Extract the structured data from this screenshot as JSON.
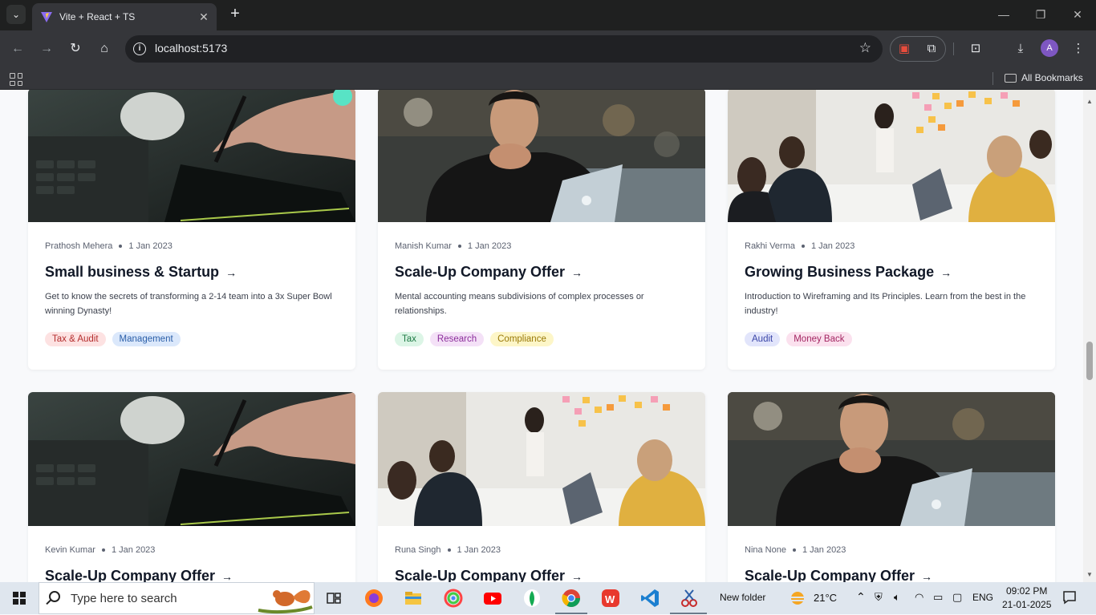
{
  "browser": {
    "tab_title": "Vite + React + TS",
    "url": "localhost:5173",
    "bookmarks_label": "All Bookmarks",
    "profile_initial": "A"
  },
  "cards": [
    {
      "author": "Prathosh Mehera",
      "date": "1 Jan 2023",
      "title": "Small business & Startup",
      "description": "Get to know the secrets of transforming a 2-14 team into a 3x Super Bowl winning Dynasty!",
      "tags": [
        {
          "label": "Tax & Audit",
          "bg": "#fde2e2",
          "fg": "#b42d2d"
        },
        {
          "label": "Management",
          "bg": "#dbe8fb",
          "fg": "#2a5ea8"
        }
      ]
    },
    {
      "author": "Manish Kumar",
      "date": "1 Jan 2023",
      "title": "Scale-Up Company Offer",
      "description": "Mental accounting means subdivisions of complex processes or relationships.",
      "tags": [
        {
          "label": "Tax",
          "bg": "#dcf5e6",
          "fg": "#1f7a45"
        },
        {
          "label": "Research",
          "bg": "#f4e1f7",
          "fg": "#8b2d9b"
        },
        {
          "label": "Compliance",
          "bg": "#fdf6c8",
          "fg": "#9a7a08"
        }
      ]
    },
    {
      "author": "Rakhi Verma",
      "date": "1 Jan 2023",
      "title": "Growing Business Package",
      "description": "Introduction to Wireframing and Its Principles. Learn from the best in the industry!",
      "tags": [
        {
          "label": "Audit",
          "bg": "#e2e5fb",
          "fg": "#3b46a8"
        },
        {
          "label": "Money Back",
          "bg": "#fbe1ee",
          "fg": "#a32662"
        }
      ]
    },
    {
      "author": "Kevin Kumar",
      "date": "1 Jan 2023",
      "title": "Scale-Up Company Offer"
    },
    {
      "author": "Runa Singh",
      "date": "1 Jan 2023",
      "title": "Scale-Up Company Offer"
    },
    {
      "author": "Nina None",
      "date": "1 Jan 2023",
      "title": "Scale-Up Company Offer"
    }
  ],
  "taskbar": {
    "search_placeholder": "Type here to search",
    "folder_label": "New folder",
    "temperature": "21°C",
    "language": "ENG",
    "time": "09:02 PM",
    "date": "21-01-2025"
  }
}
